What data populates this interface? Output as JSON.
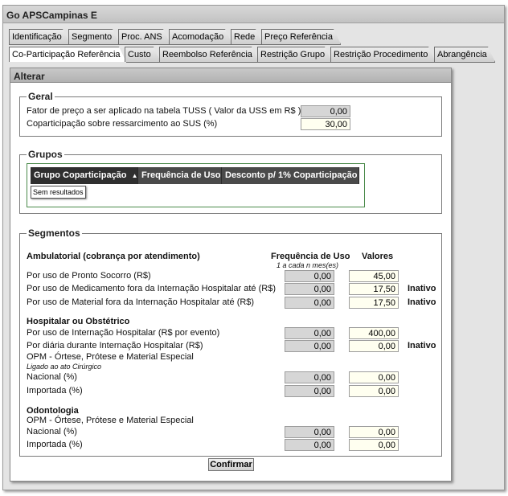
{
  "window": {
    "title": "Go APSCampinas E"
  },
  "tabs_row1": [
    "Identificação",
    "Segmento",
    "Proc. ANS",
    "Acomodação",
    "Rede",
    "Preço Referência"
  ],
  "tabs_row2": [
    "Co-Participação Referência",
    "Custo",
    "Reembolso Referência",
    "Restrição Grupo",
    "Restrição Procedimento",
    "Abrangência"
  ],
  "panel": {
    "title": "Alterar"
  },
  "geral": {
    "legend": "Geral",
    "fator_label": "Fator de preço a ser aplicado na tabela TUSS ( Valor da USS em R$ )",
    "fator_value": "0,00",
    "coparticipacao_label": "Coparticipação sobre ressarcimento ao SUS (%)",
    "coparticipacao_value": "30,00"
  },
  "grupos": {
    "legend": "Grupos",
    "columns": [
      "Grupo Coparticipação",
      "Frequência de Uso",
      "Desconto p/ 1% Coparticipação"
    ],
    "sort_indicator": "▲",
    "empty_text": "Sem resultados"
  },
  "segmentos": {
    "legend": "Segmentos",
    "col_freq": "Frequência de Uso",
    "col_freq_sub": "1 a cada n mes(es)",
    "col_valores": "Valores",
    "ambulatorial": {
      "title": "Ambulatorial (cobrança por atendimento)",
      "rows": [
        {
          "label": "Por uso de Pronto Socorro (R$)",
          "freq": "0,00",
          "valor": "45,00",
          "status": ""
        },
        {
          "label": "Por uso de Medicamento fora da Internação Hospitalar até (R$)",
          "freq": "0,00",
          "valor": "17,50",
          "status": "Inativo"
        },
        {
          "label": "Por uso de Material fora da Internação Hospitalar até (R$)",
          "freq": "0,00",
          "valor": "17,50",
          "status": "Inativo"
        }
      ]
    },
    "hospitalar": {
      "title": "Hospitalar ou Obstétrico",
      "rows": [
        {
          "label": "Por uso de Internação Hospitalar (R$ por evento)",
          "freq": "0,00",
          "valor": "400,00",
          "status": ""
        },
        {
          "label": "Por diária durante Internação Hospitalar (R$)",
          "freq": "0,00",
          "valor": "0,00",
          "status": "Inativo"
        }
      ],
      "opme_title": "OPM - Órtese, Prótese e Material Especial",
      "opme_note": "Ligado ao ato Cirúrgico",
      "opme_rows": [
        {
          "label": "Nacional (%)",
          "freq": "0,00",
          "valor": "0,00"
        },
        {
          "label": "Importada (%)",
          "freq": "0,00",
          "valor": "0,00"
        }
      ]
    },
    "odontologia": {
      "title": "Odontologia",
      "opme_title": "OPM - Órtese, Prótese e Material Especial",
      "opme_rows": [
        {
          "label": "Nacional (%)",
          "freq": "0,00",
          "valor": "0,00"
        },
        {
          "label": "Importada (%)",
          "freq": "0,00",
          "valor": "0,00"
        }
      ]
    }
  },
  "actions": {
    "confirm_label": "Confirmar"
  }
}
